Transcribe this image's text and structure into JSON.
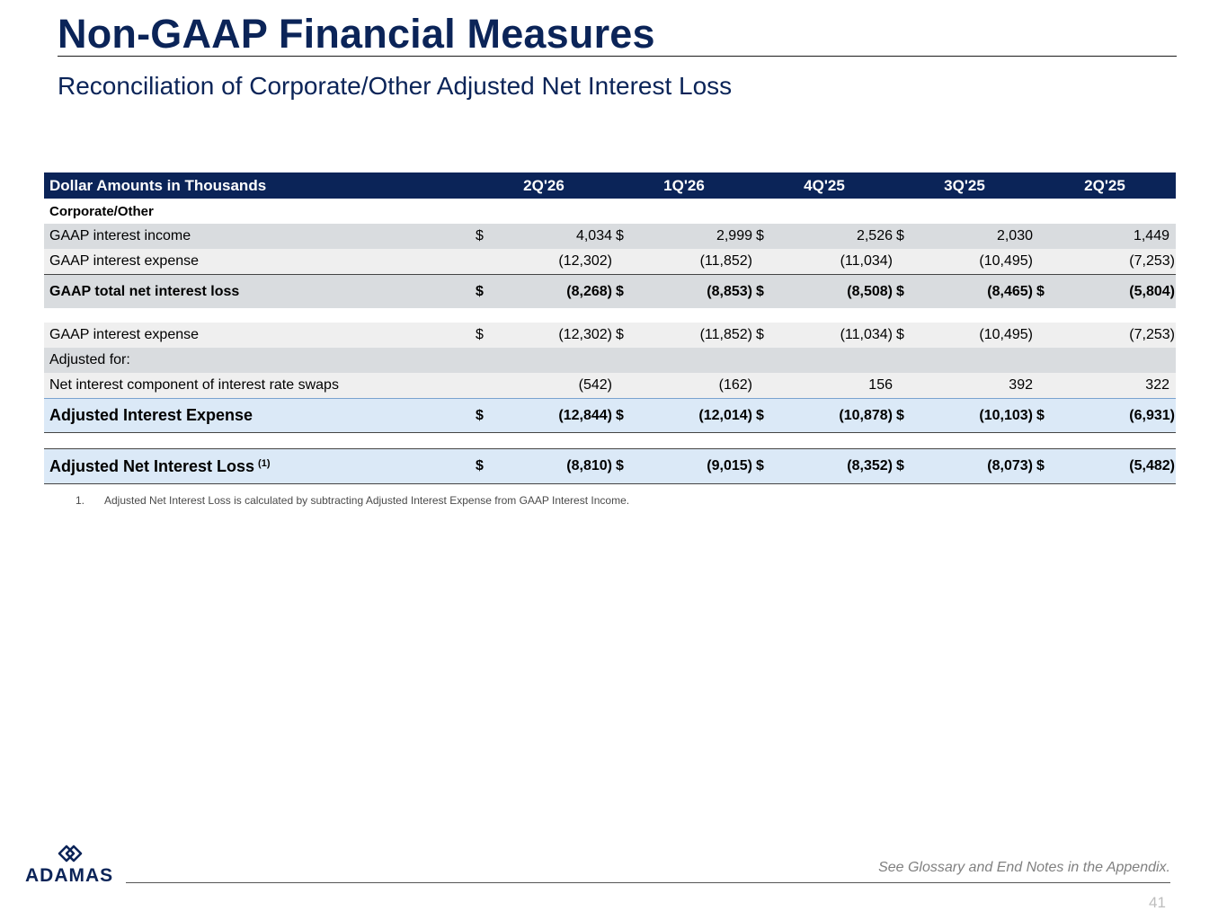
{
  "header": {
    "title": "Non-GAAP Financial Measures",
    "subtitle": "Reconciliation of Corporate/Other Adjusted Net Interest Loss"
  },
  "table": {
    "columns_label": "Dollar Amounts in Thousands",
    "periods": [
      "2Q'26",
      "1Q'26",
      "4Q'25",
      "3Q'25",
      "2Q'25"
    ],
    "section_label": "Corporate/Other",
    "rows": {
      "interest_income": {
        "label": "GAAP interest income",
        "dollar": "$",
        "values": [
          "4,034",
          "2,999",
          "2,526",
          "2,030",
          "1,449"
        ]
      },
      "interest_expense": {
        "label": "GAAP interest expense",
        "values": [
          "(12,302)",
          "(11,852)",
          "(11,034)",
          "(10,495)",
          "(7,253)"
        ]
      },
      "total_net_interest_loss": {
        "label": "GAAP total net interest loss",
        "dollar": "$",
        "values": [
          "(8,268)",
          "(8,853)",
          "(8,508)",
          "(8,465)",
          "(5,804)"
        ]
      },
      "interest_expense_2": {
        "label": "GAAP interest expense",
        "dollar": "$",
        "values": [
          "(12,302)",
          "(11,852)",
          "(11,034)",
          "(10,495)",
          "(7,253)"
        ]
      },
      "adjusted_for": {
        "label": "Adjusted for:"
      },
      "swaps": {
        "label": "Net interest component of interest rate swaps",
        "values": [
          "(542)",
          "(162)",
          "156",
          "392",
          "322"
        ]
      },
      "adjusted_interest_expense": {
        "label": "Adjusted Interest Expense",
        "dollar": "$",
        "values": [
          "(12,844)",
          "(12,014)",
          "(10,878)",
          "(10,103)",
          "(6,931)"
        ]
      },
      "adjusted_net_interest_loss": {
        "label": "Adjusted Net Interest Loss",
        "superscript": "(1)",
        "dollar": "$",
        "values": [
          "(8,810)",
          "(9,015)",
          "(8,352)",
          "(8,073)",
          "(5,482)"
        ]
      }
    }
  },
  "footnote": {
    "number": "1.",
    "text": "Adjusted Net Interest Loss is calculated by subtracting Adjusted Interest Expense from GAAP Interest Income."
  },
  "footer": {
    "logo_text": "ADAMAS",
    "glossary_note": "See Glossary and End Notes in the Appendix.",
    "page_number": "41"
  },
  "colors": {
    "navy": "#0b2458",
    "grey_row": "#d9dcdf",
    "light_row": "#efefef",
    "blue_row": "#dbe9f7"
  }
}
